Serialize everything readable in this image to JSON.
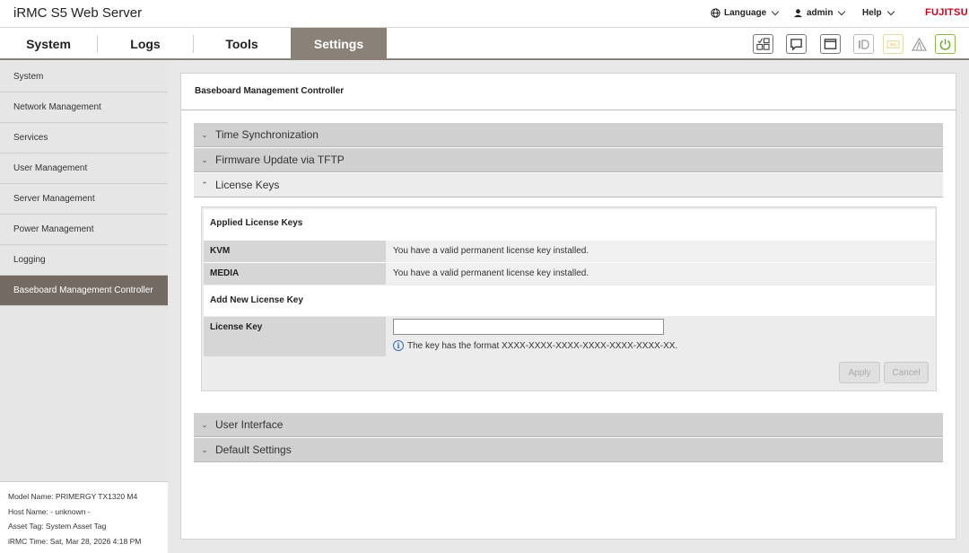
{
  "header": {
    "title": "iRMC S5 Web Server",
    "language_label": "Language",
    "user_label": "admin",
    "help_label": "Help",
    "brand": "FUJITSU"
  },
  "nav": {
    "tabs": [
      "System",
      "Logs",
      "Tools",
      "Settings"
    ],
    "active": "Settings"
  },
  "toolbar_icons": [
    "dashboard-icon",
    "chat-icon",
    "window-icon",
    "id-icon",
    "led-icon",
    "warning-icon",
    "power-icon"
  ],
  "sidebar": {
    "items": [
      "System",
      "Network Management",
      "Services",
      "User Management",
      "Server Management",
      "Power Management",
      "Logging",
      "Baseboard Management Controller"
    ],
    "active": "Baseboard Management Controller"
  },
  "system_info": {
    "model": "Model Name: PRIMERGY TX1320 M4",
    "host": "Host Name: - unknown -",
    "asset": "Asset Tag: System Asset Tag",
    "time": "iRMC Time: Sat, Mar 28, 2026 4:18 PM"
  },
  "panel": {
    "title": "Baseboard Management Controller",
    "sections": [
      "Time Synchronization",
      "Firmware Update via TFTP",
      "License Keys",
      "User Interface",
      "Default Settings"
    ],
    "expanded": "License Keys"
  },
  "license": {
    "applied_title": "Applied License Keys",
    "rows": [
      {
        "name": "KVM",
        "status": "You have a valid permanent license key installed."
      },
      {
        "name": "MEDIA",
        "status": "You have a valid permanent license key installed."
      }
    ],
    "add_title": "Add New License Key",
    "field_label": "License Key",
    "field_value": "",
    "hint": "The key has the format XXXX-XXXX-XXXX-XXXX-XXXX-XXXX-XX.",
    "apply_label": "Apply",
    "cancel_label": "Cancel"
  },
  "colors": {
    "accent": "#8a8178",
    "sidebar_active": "#736b63",
    "brand_red": "#d0021b"
  }
}
